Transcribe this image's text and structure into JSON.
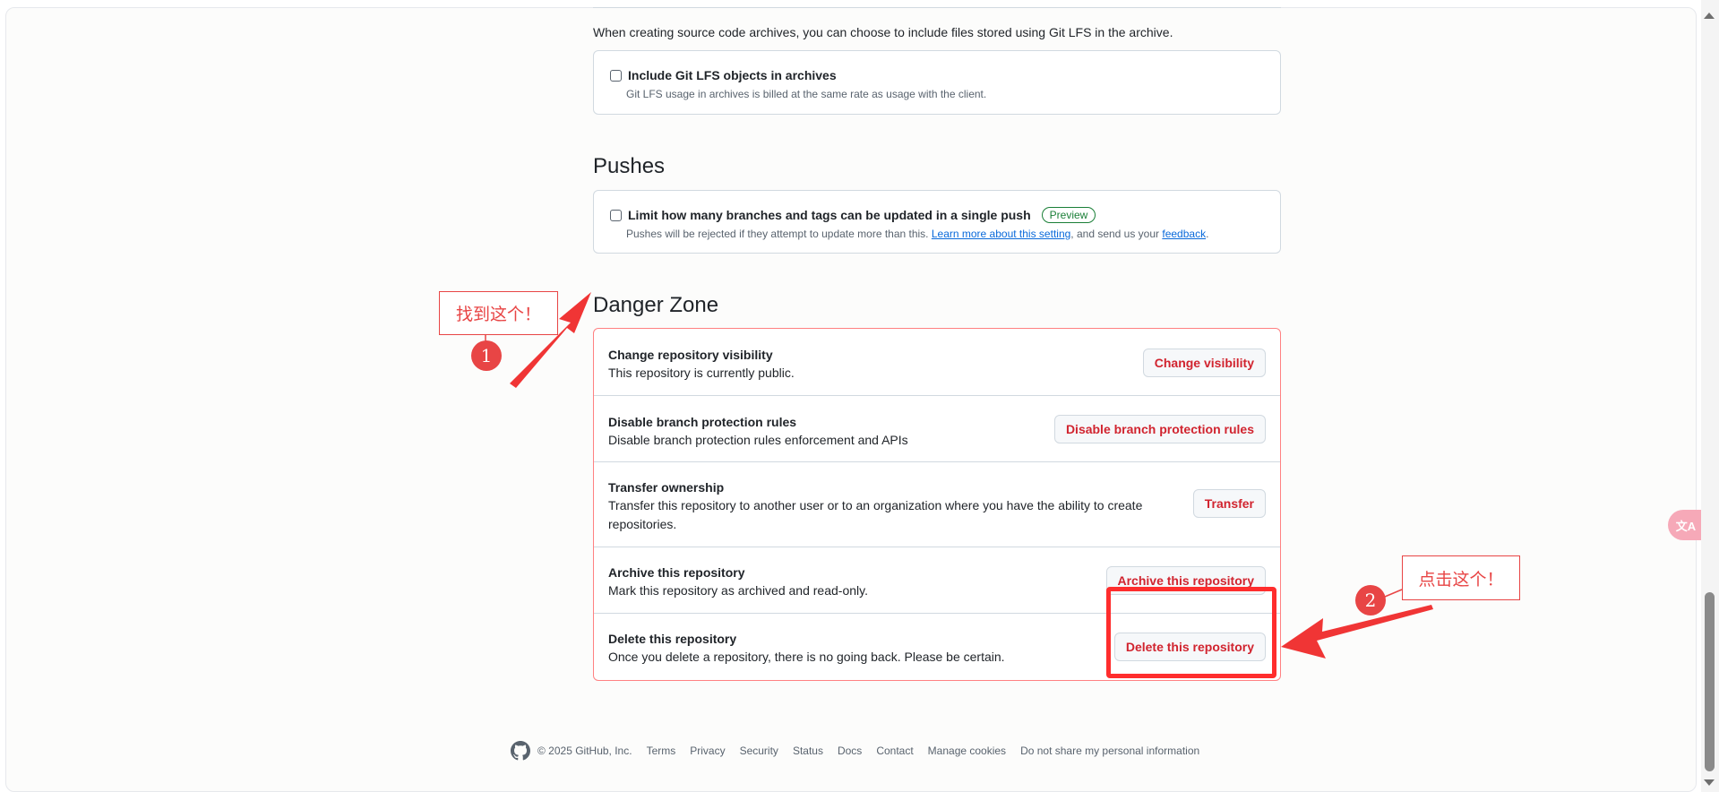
{
  "archives": {
    "description": "When creating source code archives, you can choose to include files stored using Git LFS in the archive.",
    "checkbox_label": "Include Git LFS objects in archives",
    "checkbox_note": "Git LFS usage in archives is billed at the same rate as usage with the client.",
    "checked": false
  },
  "pushes": {
    "title": "Pushes",
    "checkbox_label": "Limit how many branches and tags can be updated in a single push",
    "badge": "Preview",
    "note_before": "Pushes will be rejected if they attempt to update more than this. ",
    "learn_more": "Learn more about this setting",
    "note_middle": ", and send us your ",
    "feedback": "feedback",
    "note_end": ".",
    "checked": false
  },
  "danger_zone": {
    "title": "Danger Zone",
    "rows": [
      {
        "title": "Change repository visibility",
        "desc": "This repository is currently public.",
        "button": "Change visibility"
      },
      {
        "title": "Disable branch protection rules",
        "desc": "Disable branch protection rules enforcement and APIs",
        "button": "Disable branch protection rules"
      },
      {
        "title": "Transfer ownership",
        "desc": "Transfer this repository to another user or to an organization where you have the ability to create repositories.",
        "button": "Transfer"
      },
      {
        "title": "Archive this repository",
        "desc": "Mark this repository as archived and read-only.",
        "button": "Archive this repository"
      },
      {
        "title": "Delete this repository",
        "desc": "Once you delete a repository, there is no going back. Please be certain.",
        "button": "Delete this repository"
      }
    ]
  },
  "annotations": {
    "callout_1": "找到这个！",
    "marker_1": "1",
    "callout_2": "点击这个！",
    "marker_2": "2",
    "color": "#e84545",
    "highlight_color": "#ff2d2d"
  },
  "footer": {
    "copyright": "© 2025 GitHub, Inc.",
    "links": [
      "Terms",
      "Privacy",
      "Security",
      "Status",
      "Docs",
      "Contact",
      "Manage cookies",
      "Do not share my personal information"
    ]
  },
  "translate_widget": {
    "icon": "translate-icon",
    "label": "文A"
  },
  "colors": {
    "danger": "#d1242f",
    "danger_border": "#ff8182",
    "link": "#0969da",
    "success": "#1a7f37"
  }
}
